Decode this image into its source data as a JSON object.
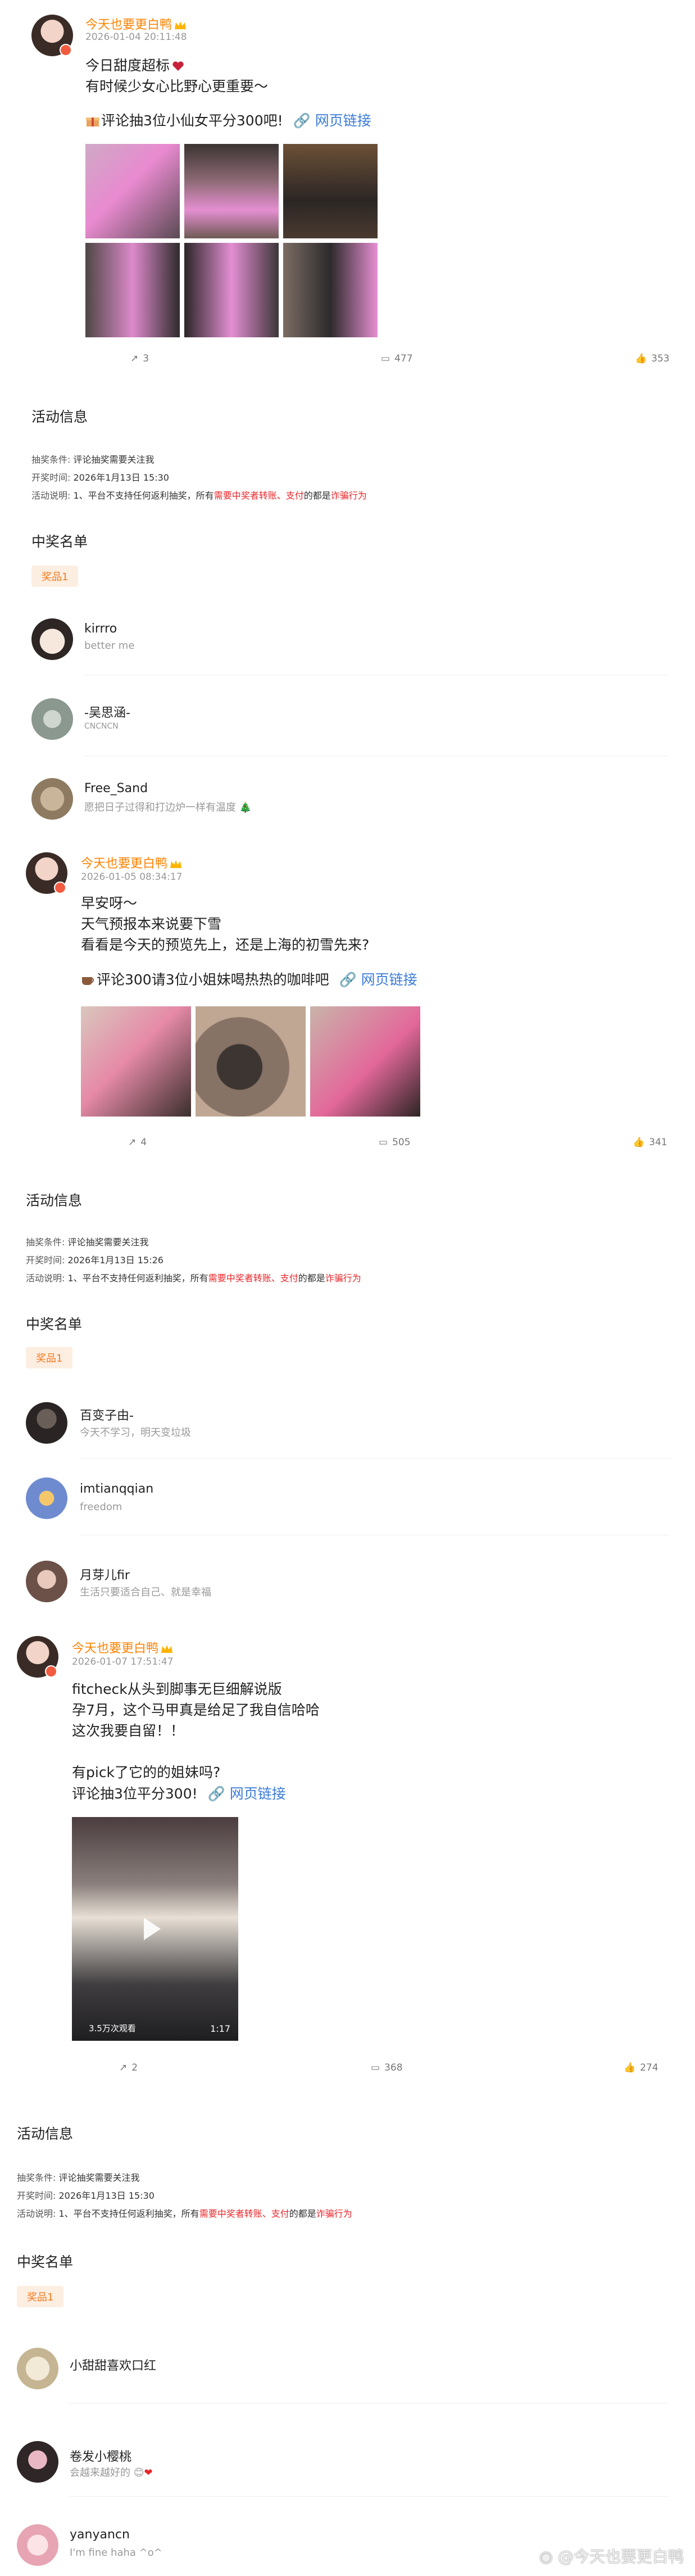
{
  "posts": [
    {
      "username": "今天也要更白鸭",
      "time": "2026-01-04 20:11:48",
      "lines": [
        "今日甜度超标",
        "有时候少女心比野心更重要～"
      ],
      "lottery_text": "评论抽3位小仙女平分300吧!",
      "link_text": "网页链接",
      "reposts": "3",
      "comments": "477",
      "likes": "353"
    },
    {
      "username": "今天也要更白鸭",
      "time": "2026-01-05 08:34:17",
      "lines": [
        "早安呀～",
        "天气预报本来说要下雪",
        "看看是今天的预览先上，还是上海的初雪先来?"
      ],
      "lottery_text": "评论300请3位小姐妹喝热热的咖啡吧",
      "link_text": "网页链接",
      "reposts": "4",
      "comments": "505",
      "likes": "341"
    },
    {
      "username": "今天也要更白鸭",
      "time": "2026-01-07 17:51:47",
      "lines": [
        "fitcheck从头到脚事无巨细解说版",
        "孕7月，这个马甲真是给足了我自信哈哈",
        "这次我要自留！！",
        "",
        "有pick了它的的姐妹吗?"
      ],
      "lottery_text": "评论抽3位平分300!",
      "link_text": "网页链接",
      "video_views": "3.5万次观看",
      "video_duration": "1:17",
      "reposts": "2",
      "comments": "368",
      "likes": "274"
    }
  ],
  "activities": [
    {
      "title": "活动信息",
      "cond_label": "抽奖条件:",
      "cond_value": "评论抽奖需要关注我",
      "time_label": "开奖时间:",
      "time_value": "2026年1月13日 15:30",
      "desc_label": "活动说明:",
      "desc_a": "1、平台不支持任何返利抽奖，所有",
      "desc_b": "需要中奖者转账、支付",
      "desc_c": "的都是",
      "desc_d": "诈骗行为",
      "winners_title": "中奖名单",
      "prize": "奖品1",
      "winners": [
        {
          "name": "kirrro",
          "sub": "better me"
        },
        {
          "name": "-吴思涵-",
          "sub": "CNCNCN"
        },
        {
          "name": "Free_Sand",
          "sub": "愿把日子过得和打边炉一样有温度"
        }
      ]
    },
    {
      "title": "活动信息",
      "cond_label": "抽奖条件:",
      "cond_value": "评论抽奖需要关注我",
      "time_label": "开奖时间:",
      "time_value": "2026年1月13日 15:26",
      "desc_label": "活动说明:",
      "desc_a": "1、平台不支持任何返利抽奖，所有",
      "desc_b": "需要中奖者转账、支付",
      "desc_c": "的都是",
      "desc_d": "诈骗行为",
      "winners_title": "中奖名单",
      "prize": "奖品1",
      "winners": [
        {
          "name": "百变子由-",
          "sub": "今天不学习，明天变垃圾"
        },
        {
          "name": "imtianqqian",
          "sub": "freedom"
        },
        {
          "name": "月芽儿fir",
          "sub": "生活只要适合自己、就是幸福"
        }
      ]
    },
    {
      "title": "活动信息",
      "cond_label": "抽奖条件:",
      "cond_value": "评论抽奖需要关注我",
      "time_label": "开奖时间:",
      "time_value": "2026年1月13日 15:30",
      "desc_label": "活动说明:",
      "desc_a": "1、平台不支持任何返利抽奖，所有",
      "desc_b": "需要中奖者转账、支付",
      "desc_c": "的都是",
      "desc_d": "诈骗行为",
      "winners_title": "中奖名单",
      "prize": "奖品1",
      "winners": [
        {
          "name": "小甜甜喜欢口红",
          "sub": ""
        },
        {
          "name": "卷发小樱桃",
          "sub": "会越来越好的"
        },
        {
          "name": "yanyancn",
          "sub": "I'm fine haha ^o^"
        }
      ]
    }
  ],
  "watermark": "@今天也要更白鸭",
  "colors": {
    "accent": "#ff8200",
    "link": "#3b7bd8",
    "warning": "#e8262a",
    "prize_bg": "#fdeee2"
  }
}
